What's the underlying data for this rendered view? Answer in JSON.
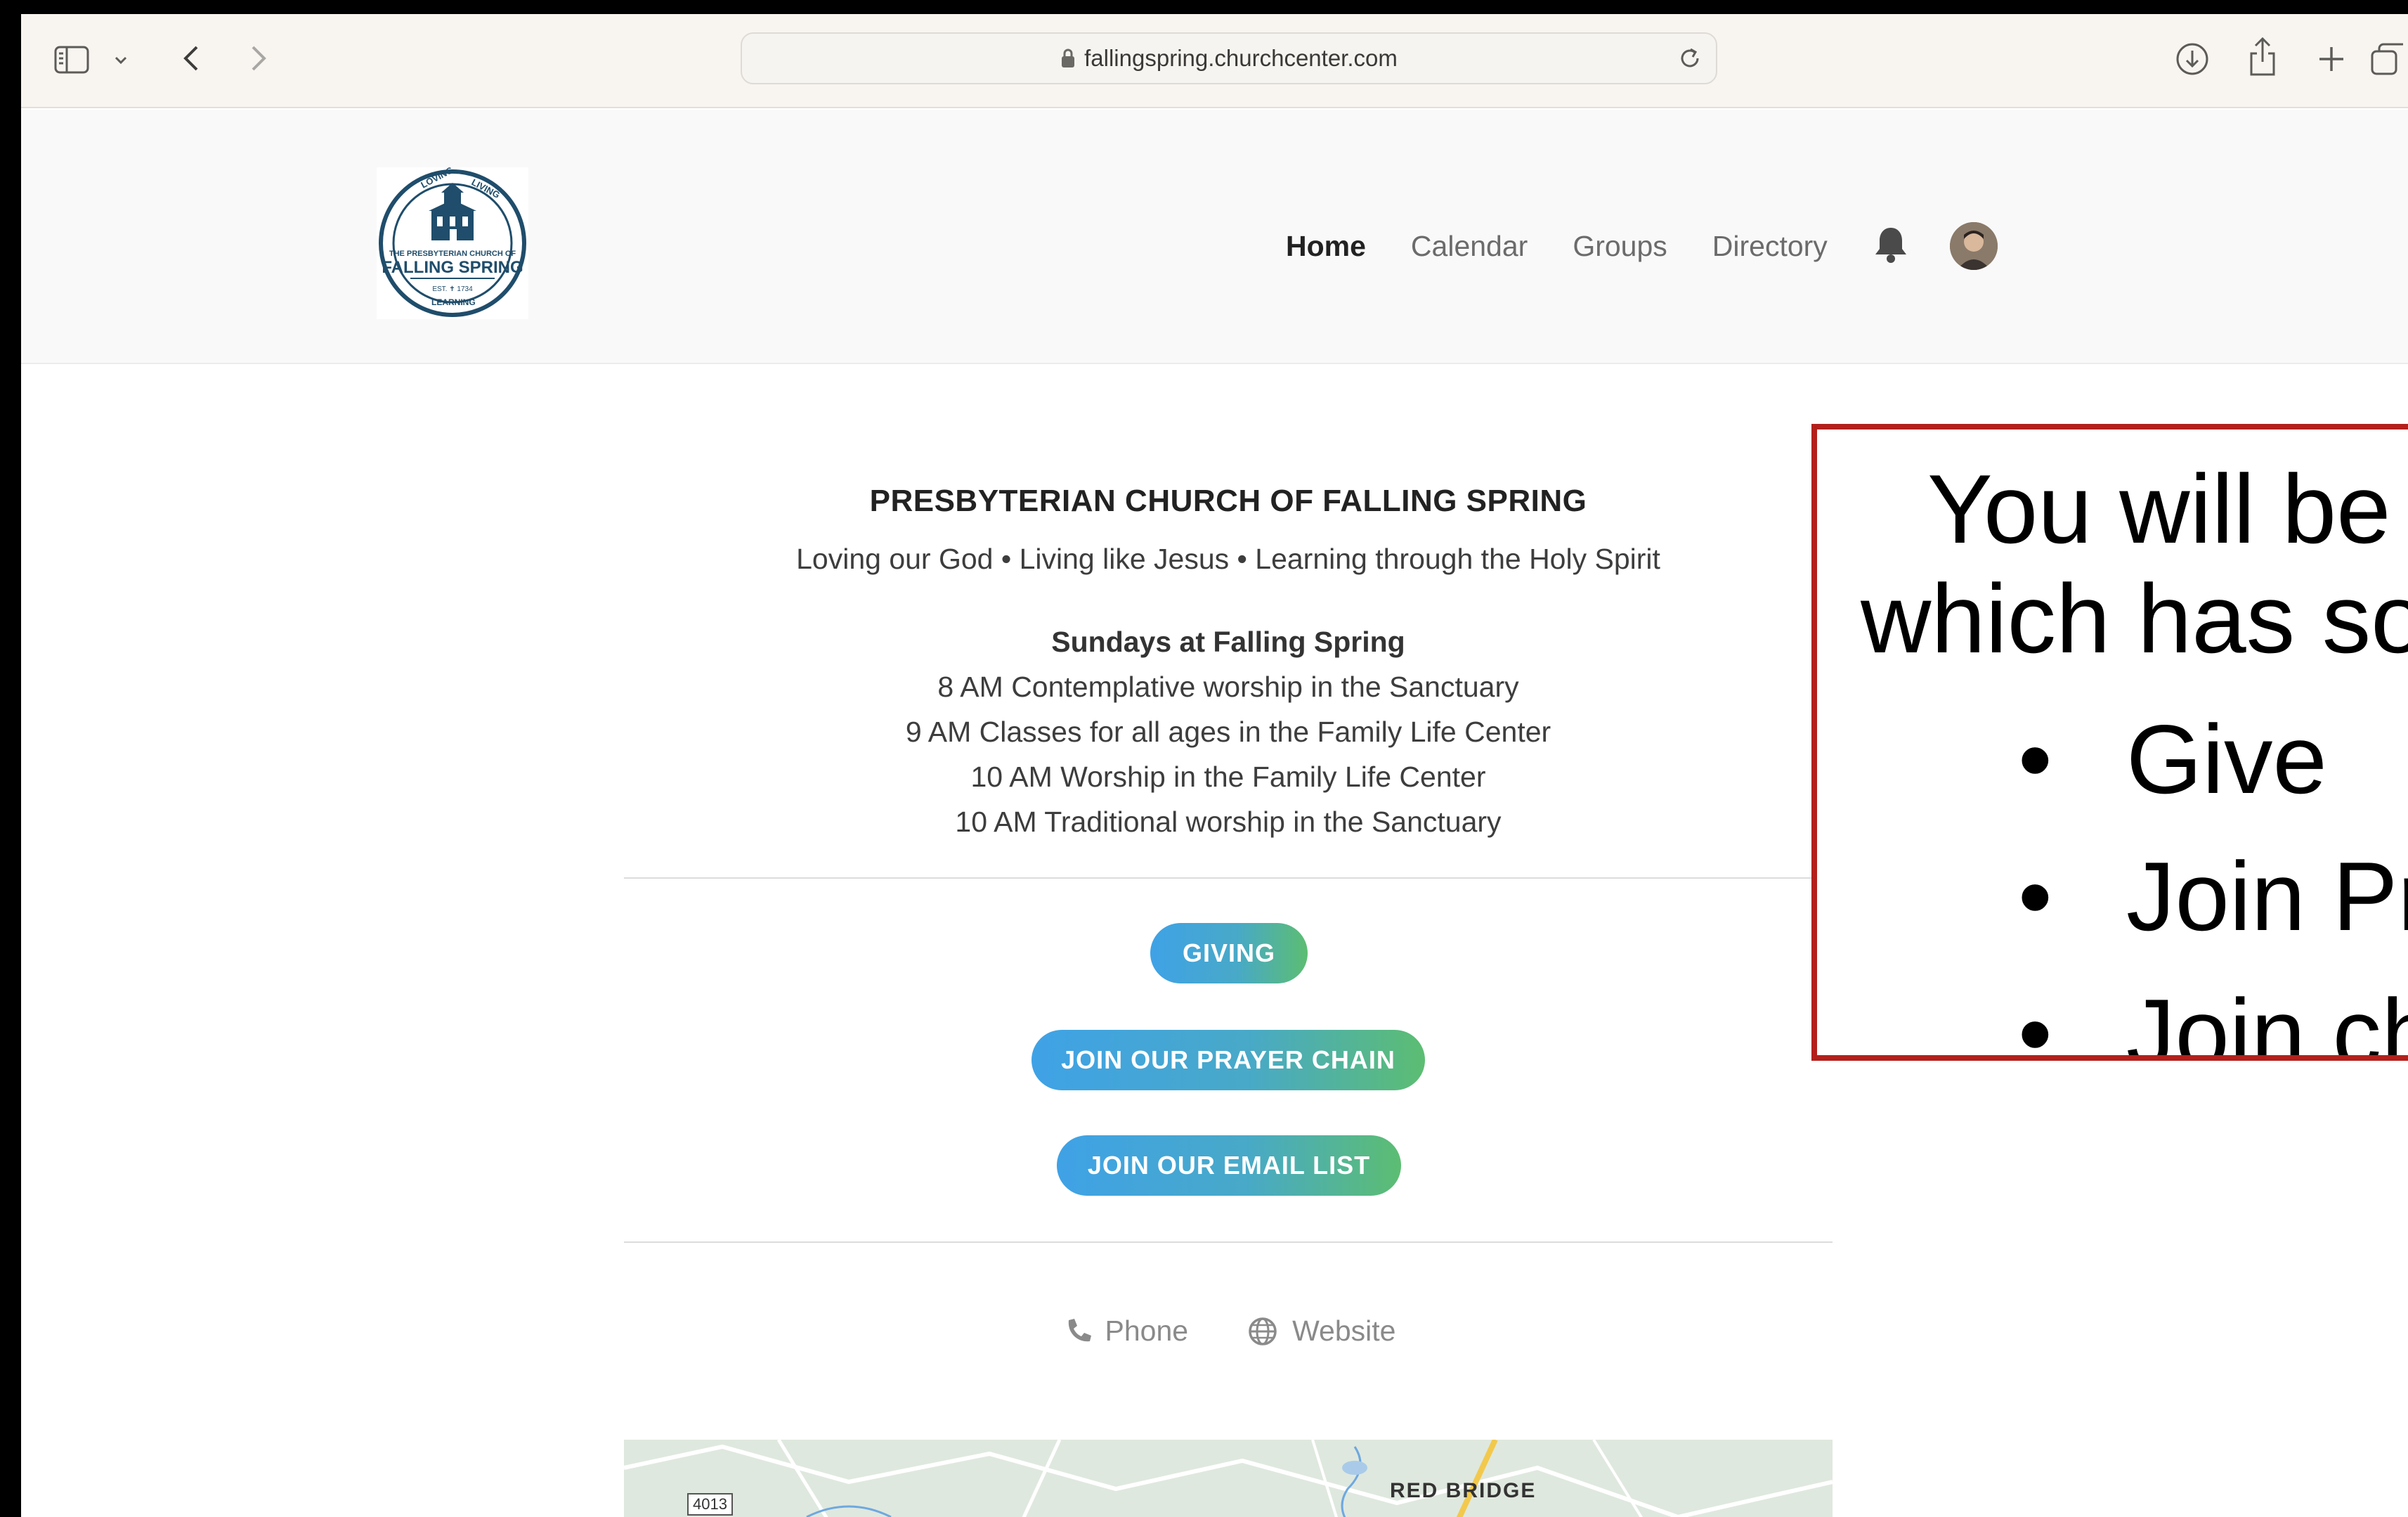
{
  "browser": {
    "url": "fallingspring.churchcenter.com"
  },
  "header": {
    "logo_alt": "THE PRESBYTERIAN CHURCH OF FALLING SPRING",
    "logo_text_top": "LOVING",
    "logo_text_right": "LIVING",
    "logo_text_bottom": "LEARNING",
    "logo_name_1": "THE PRESBYTERIAN CHURCH OF",
    "logo_name_2": "FALLING SPRING",
    "logo_est": "EST. 1734",
    "nav": [
      {
        "label": "Home",
        "active": true
      },
      {
        "label": "Calendar",
        "active": false
      },
      {
        "label": "Groups",
        "active": false
      },
      {
        "label": "Directory",
        "active": false
      }
    ]
  },
  "main": {
    "title": "PRESBYTERIAN CHURCH OF FALLING SPRING",
    "tagline": "Loving our God • Living like Jesus • Learning through the Holy Spirit",
    "schedule_heading": "Sundays at Falling Spring",
    "schedule": [
      "8 AM Contemplative worship in the Sanctuary",
      "9 AM Classes for all ages in the Family Life Center",
      "10 AM Worship in the Family Life Center",
      "10 AM Traditional worship in the Sanctuary"
    ],
    "buttons": {
      "giving": "GIVING",
      "prayer": "JOIN OUR PRAYER CHAIN",
      "email": "JOIN OUR EMAIL LIST"
    },
    "contact": {
      "phone": "Phone",
      "website": "Website"
    },
    "map": {
      "label_area": "RED BRIDGE",
      "label_road": "4013"
    }
  },
  "callout": {
    "line_1": "You will be",
    "line_2": "which has so",
    "bullets": [
      "Give",
      "Join Pr",
      "Join ch"
    ]
  },
  "colors": {
    "callout_border": "#b3201c",
    "button_gradient_start": "#3fa2e6",
    "button_gradient_end": "#5cbd72",
    "logo_navy": "#1f4d6b"
  }
}
